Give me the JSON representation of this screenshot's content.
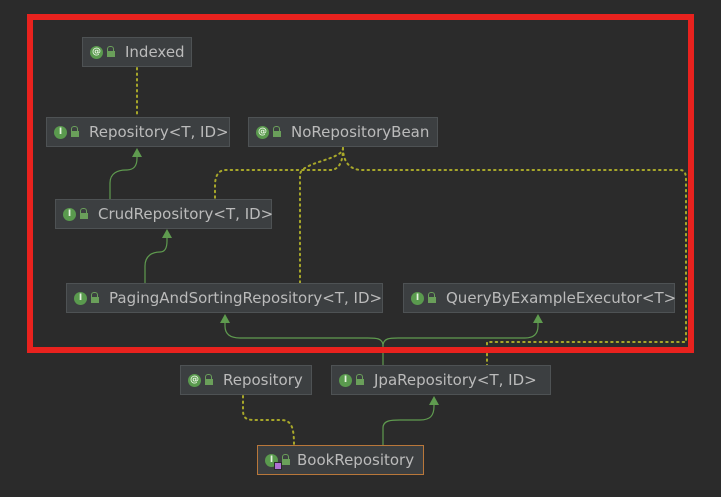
{
  "colors": {
    "background": "#2b2b2b",
    "node_fill": "#3c3f41",
    "node_border": "#4e5254",
    "selected_border": "#b9773a",
    "inherit_arrow": "#5f9b4f",
    "annotation_link": "#a8a82a",
    "highlight_frame": "#e8221e"
  },
  "diagram": {
    "nodes": [
      {
        "id": "indexed",
        "label": "Indexed",
        "kind": "annotation",
        "icon": "annotation-icon"
      },
      {
        "id": "repository_generic",
        "label": "Repository<T, ID>",
        "kind": "interface",
        "icon": "interface-icon"
      },
      {
        "id": "norepositorybean",
        "label": "NoRepositoryBean",
        "kind": "annotation",
        "icon": "annotation-icon"
      },
      {
        "id": "crudrepository",
        "label": "CrudRepository<T, ID>",
        "kind": "interface",
        "icon": "interface-icon"
      },
      {
        "id": "pagingandsorting",
        "label": "PagingAndSortingRepository<T, ID>",
        "kind": "interface",
        "icon": "interface-icon"
      },
      {
        "id": "querybyexample",
        "label": "QueryByExampleExecutor<T>",
        "kind": "interface",
        "icon": "interface-icon"
      },
      {
        "id": "repository_anno",
        "label": "Repository",
        "kind": "annotation",
        "icon": "annotation-icon"
      },
      {
        "id": "jparepository",
        "label": "JpaRepository<T, ID>",
        "kind": "interface",
        "icon": "interface-icon"
      },
      {
        "id": "bookrepository",
        "label": "BookRepository",
        "kind": "interface",
        "icon": "interface-icon",
        "selected": true
      }
    ],
    "inheritance": [
      {
        "from": "crudrepository",
        "to": "repository_generic"
      },
      {
        "from": "pagingandsorting",
        "to": "crudrepository"
      },
      {
        "from": "jparepository",
        "to": "pagingandsorting"
      },
      {
        "from": "jparepository",
        "to": "querybyexample"
      },
      {
        "from": "bookrepository",
        "to": "jparepository"
      }
    ],
    "annotation_links": [
      {
        "from": "repository_generic",
        "to": "indexed"
      },
      {
        "from": "crudrepository",
        "to": "norepositorybean"
      },
      {
        "from": "pagingandsorting",
        "to": "norepositorybean"
      },
      {
        "from": "jparepository",
        "to": "norepositorybean"
      },
      {
        "from": "bookrepository",
        "to": "repository_anno"
      }
    ]
  }
}
